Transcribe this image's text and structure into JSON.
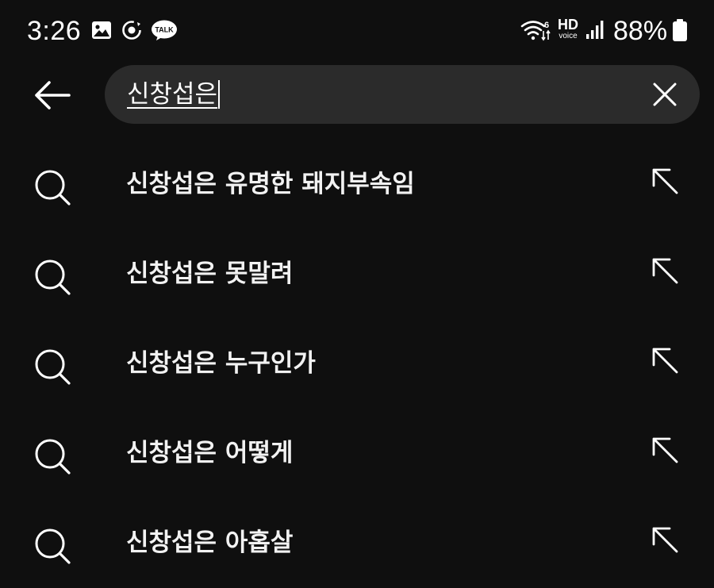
{
  "status_bar": {
    "time": "3:26",
    "network_hd_top": "HD",
    "network_hd_bottom": "voice",
    "battery_percent": "88%",
    "icons": [
      "gallery-icon",
      "sync-icon",
      "kakaotalk-icon",
      "wifi-icon",
      "hd-voice-icon",
      "signal-icon",
      "battery-icon"
    ],
    "talk_label": "TALK",
    "wifi_label": "6"
  },
  "search": {
    "query": "신창섭은",
    "back_icon": "arrow-left-icon",
    "clear_icon": "close-icon"
  },
  "suggestions": [
    {
      "text": "신창섭은 유명한 돼지부속임"
    },
    {
      "text": "신창섭은 못말려"
    },
    {
      "text": "신창섭은 누구인가"
    },
    {
      "text": "신창섭은 어떻게"
    },
    {
      "text": "신창섭은 아홉살"
    }
  ],
  "colors": {
    "background": "#0f0f0f",
    "search_box": "#2b2b2b",
    "text": "#ffffff"
  }
}
